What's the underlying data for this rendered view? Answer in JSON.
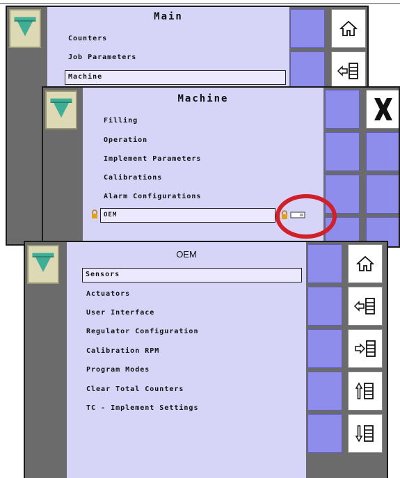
{
  "screens": {
    "main": {
      "title": "Main",
      "items": [
        "Counters",
        "Job Parameters",
        "Machine"
      ]
    },
    "machine": {
      "title": "Machine",
      "items": [
        "Filling",
        "Operation",
        "Implement Parameters",
        "Calibrations",
        "Alarm Configurations",
        "OEM"
      ]
    },
    "oem": {
      "title": "OEM",
      "items": [
        "Sensors",
        "Actuators",
        "User Interface",
        "Regulator Configuration",
        "Calibration RPM",
        "Program Modes",
        "Clear Total Counters",
        "TC - Implement Settings"
      ]
    }
  },
  "icons": {
    "logo": "spreader-logo-icon",
    "home": "home-icon",
    "back": "back-arrow-list-icon",
    "forward": "forward-arrow-list-icon",
    "page_up": "page-up-list-icon",
    "page_down": "page-down-list-icon",
    "close": "close-x-icon",
    "lock": "padlock-icon",
    "key": "key-card-icon"
  },
  "colors": {
    "menu_bg": "#d6d4f7",
    "button_bg": "#8f8dec",
    "frame_bg": "#6b6b6b",
    "highlight_circle": "#d0202a"
  }
}
